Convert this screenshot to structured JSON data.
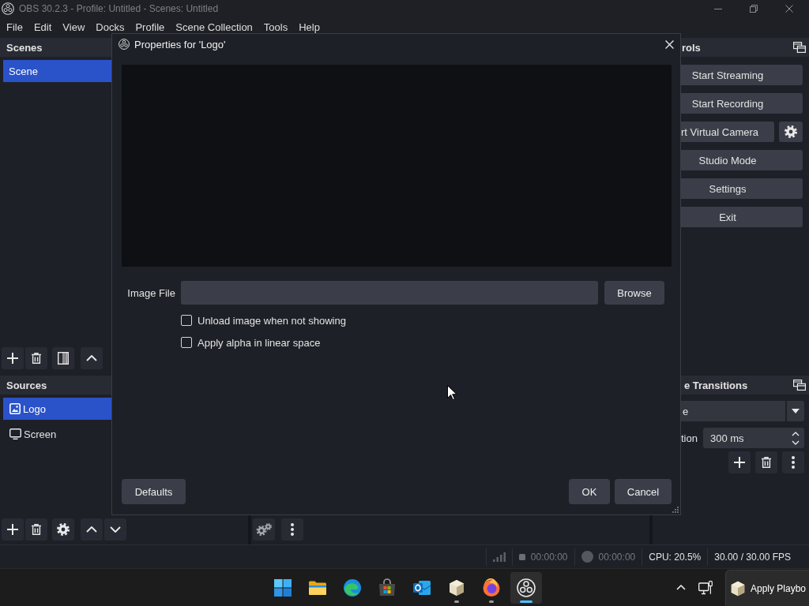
{
  "window": {
    "title": "OBS 30.2.3 - Profile: Untitled - Scenes: Untitled"
  },
  "menu": [
    "File",
    "Edit",
    "View",
    "Docks",
    "Profile",
    "Scene Collection",
    "Tools",
    "Help"
  ],
  "scenes": {
    "title": "Scenes",
    "items": [
      {
        "label": "Scene",
        "selected": true
      }
    ]
  },
  "sources": {
    "title": "Sources",
    "items": [
      {
        "label": "Logo",
        "kind": "image",
        "selected": true
      },
      {
        "label": "Screen",
        "kind": "display",
        "selected": false
      }
    ]
  },
  "controls": {
    "title": "rols",
    "buttons": [
      {
        "label": "Start Streaming",
        "kind": "plain"
      },
      {
        "label": "Start Recording",
        "kind": "plain"
      },
      {
        "label": "rt Virtual Camera",
        "kind": "with_settings"
      },
      {
        "label": "Studio Mode",
        "kind": "plain"
      },
      {
        "label": "Settings",
        "kind": "plain"
      },
      {
        "label": "Exit",
        "kind": "plain"
      }
    ]
  },
  "transitions": {
    "title": "e Transitions",
    "transition": "e",
    "duration_label": "tion",
    "duration": "300 ms"
  },
  "dialog": {
    "title": "Properties for 'Logo'",
    "image_file": {
      "label": "Image File",
      "button": "Browse"
    },
    "checkboxes": [
      {
        "label": "Unload image when not showing",
        "checked": false
      },
      {
        "label": "Apply alpha in linear space",
        "checked": false
      }
    ],
    "defaults": "Defaults",
    "ok": "OK",
    "cancel": "Cancel"
  },
  "status_bar": {
    "stream_time": "00:00:00",
    "record_time": "00:00:00",
    "cpu": "CPU: 20.5%",
    "fps": "30.00 / 30.00 FPS"
  },
  "taskbar": {
    "apps": [
      {
        "kind": "start",
        "running": false,
        "selected": false
      },
      {
        "kind": "folder",
        "running": false,
        "selected": false
      },
      {
        "kind": "wave",
        "running": false,
        "selected": false
      },
      {
        "kind": "store",
        "running": false,
        "selected": false
      },
      {
        "kind": "mail",
        "running": false,
        "selected": false
      },
      {
        "kind": "box",
        "running": true,
        "selected": false
      },
      {
        "kind": "fox",
        "running": true,
        "selected": false
      },
      {
        "kind": "obs",
        "running": true,
        "selected": true
      }
    ],
    "notification": "Apply Playbo"
  }
}
